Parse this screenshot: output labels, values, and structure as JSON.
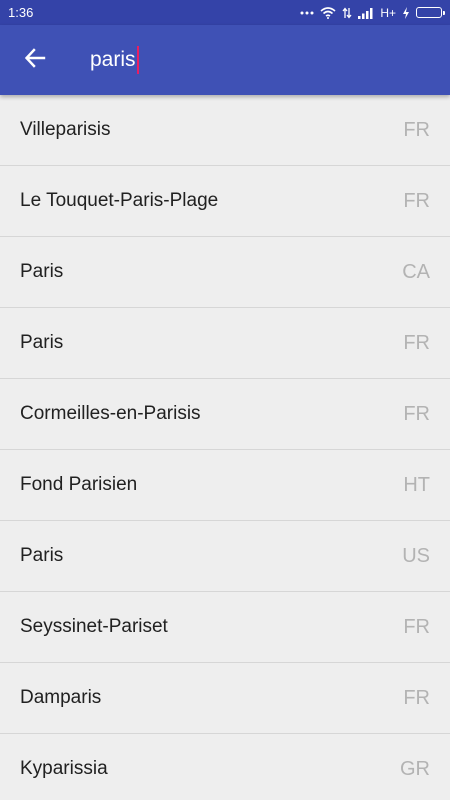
{
  "status_bar": {
    "time": "1:36",
    "network": "H+",
    "icons": [
      "more-dots-icon",
      "wifi-icon",
      "data-arrows-icon",
      "signal-icon",
      "charging-icon",
      "battery-icon"
    ]
  },
  "app_bar": {
    "back_icon": "arrow-back-icon",
    "search_value": "paris",
    "colors": {
      "primary": "#3f51b5",
      "status": "#3443a8",
      "caret": "#e91e63"
    }
  },
  "results": [
    {
      "city": "Villeparisis",
      "country": "FR"
    },
    {
      "city": "Le Touquet-Paris-Plage",
      "country": "FR"
    },
    {
      "city": "Paris",
      "country": "CA"
    },
    {
      "city": "Paris",
      "country": "FR"
    },
    {
      "city": "Cormeilles-en-Parisis",
      "country": "FR"
    },
    {
      "city": "Fond Parisien",
      "country": "HT"
    },
    {
      "city": "Paris",
      "country": "US"
    },
    {
      "city": "Seyssinet-Pariset",
      "country": "FR"
    },
    {
      "city": "Damparis",
      "country": "FR"
    },
    {
      "city": "Kyparissia",
      "country": "GR"
    }
  ]
}
